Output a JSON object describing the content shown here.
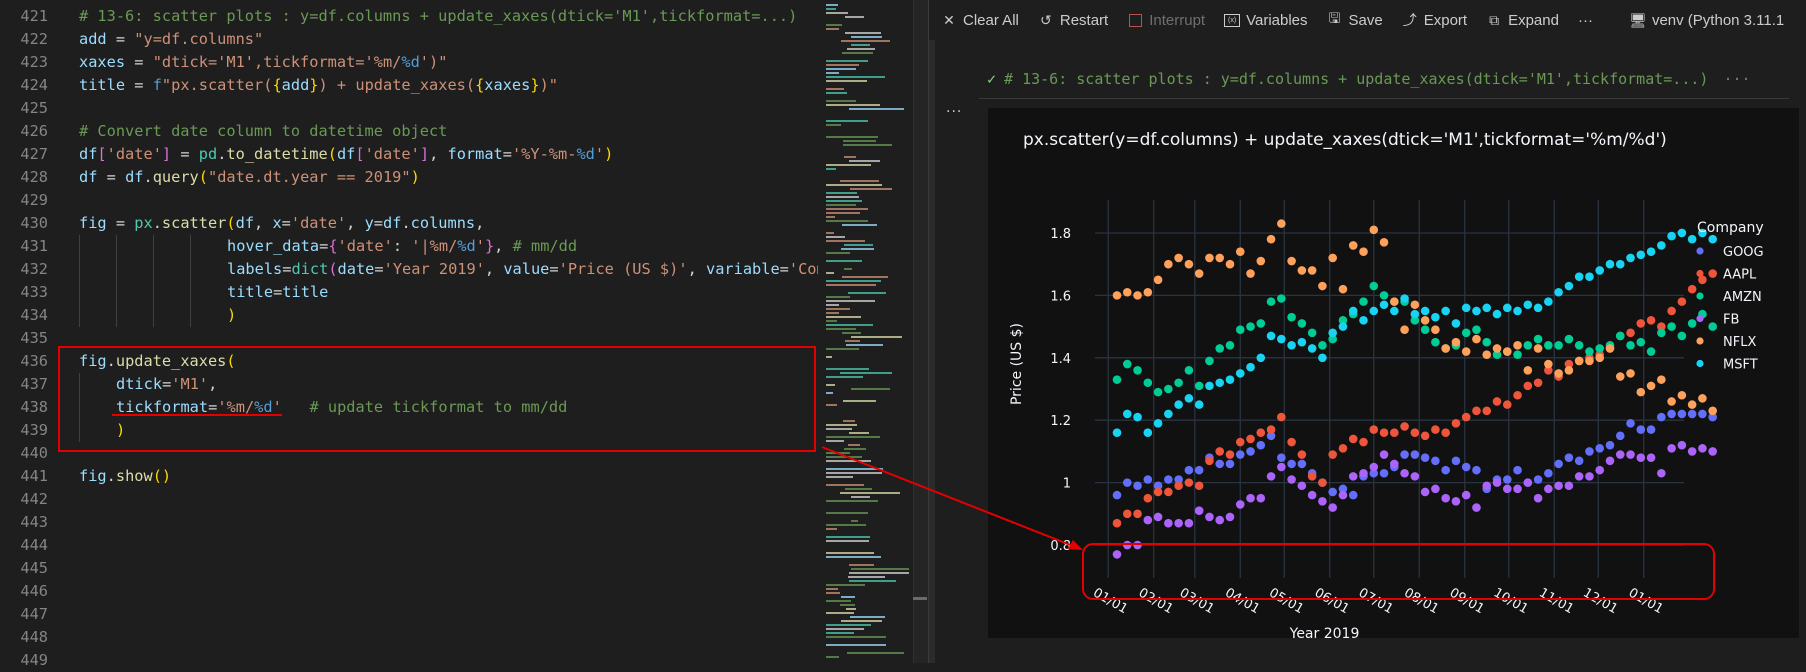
{
  "editor": {
    "lines": [
      {
        "n": "421",
        "tokens": [
          [
            "c-com",
            "# 13-6: scatter plots : y=df.columns + update_xaxes(dtick='M1',tickformat=...)"
          ]
        ]
      },
      {
        "n": "422",
        "tokens": [
          [
            "c-var",
            "add"
          ],
          [
            "c-op",
            " = "
          ],
          [
            "c-str",
            "\"y=df.columns\""
          ]
        ]
      },
      {
        "n": "423",
        "tokens": [
          [
            "c-var",
            "xaxes"
          ],
          [
            "c-op",
            " = "
          ],
          [
            "c-str",
            "\"dtick='M1',tickformat='"
          ],
          [
            "c-str",
            "%m/"
          ],
          [
            "c-esc",
            "%d"
          ],
          [
            "c-str",
            "')\""
          ]
        ]
      },
      {
        "n": "424",
        "tokens": [
          [
            "c-var",
            "title"
          ],
          [
            "c-op",
            " = "
          ],
          [
            "c-esc",
            "f"
          ],
          [
            "c-str",
            "\"px.scatter("
          ],
          [
            "c-br1",
            "{"
          ],
          [
            "c-var",
            "add"
          ],
          [
            "c-br1",
            "}"
          ],
          [
            "c-str",
            ") + update_xaxes("
          ],
          [
            "c-br1",
            "{"
          ],
          [
            "c-var",
            "xaxes"
          ],
          [
            "c-br1",
            "}"
          ],
          [
            "c-str",
            ")\""
          ]
        ]
      },
      {
        "n": "425",
        "tokens": []
      },
      {
        "n": "426",
        "tokens": [
          [
            "c-com",
            "# Convert date column to datetime object"
          ]
        ]
      },
      {
        "n": "427",
        "tokens": [
          [
            "c-var",
            "df"
          ],
          [
            "c-br2",
            "["
          ],
          [
            "c-str",
            "'date'"
          ],
          [
            "c-br2",
            "]"
          ],
          [
            "c-op",
            " = "
          ],
          [
            "c-mod",
            "pd"
          ],
          [
            "c-op",
            "."
          ],
          [
            "c-fn",
            "to_datetime"
          ],
          [
            "c-br1",
            "("
          ],
          [
            "c-var",
            "df"
          ],
          [
            "c-br2",
            "["
          ],
          [
            "c-str",
            "'date'"
          ],
          [
            "c-br2",
            "]"
          ],
          [
            "c-op",
            ", "
          ],
          [
            "c-var",
            "format"
          ],
          [
            "c-op",
            "="
          ],
          [
            "c-str",
            "'%Y-%m-"
          ],
          [
            "c-esc",
            "%d"
          ],
          [
            "c-str",
            "'"
          ],
          [
            "c-br1",
            ")"
          ]
        ]
      },
      {
        "n": "428",
        "tokens": [
          [
            "c-var",
            "df"
          ],
          [
            "c-op",
            " = "
          ],
          [
            "c-var",
            "df"
          ],
          [
            "c-op",
            "."
          ],
          [
            "c-fn",
            "query"
          ],
          [
            "c-br1",
            "("
          ],
          [
            "c-str",
            "\"date.dt.year == 2019\""
          ],
          [
            "c-br1",
            ")"
          ]
        ]
      },
      {
        "n": "429",
        "tokens": []
      },
      {
        "n": "430",
        "tokens": [
          [
            "c-var",
            "fig"
          ],
          [
            "c-op",
            " = "
          ],
          [
            "c-mod",
            "px"
          ],
          [
            "c-op",
            "."
          ],
          [
            "c-fn",
            "scatter"
          ],
          [
            "c-br1",
            "("
          ],
          [
            "c-var",
            "df"
          ],
          [
            "c-op",
            ", "
          ],
          [
            "c-var",
            "x"
          ],
          [
            "c-op",
            "="
          ],
          [
            "c-str",
            "'date'"
          ],
          [
            "c-op",
            ", "
          ],
          [
            "c-var",
            "y"
          ],
          [
            "c-op",
            "="
          ],
          [
            "c-var",
            "df"
          ],
          [
            "c-op",
            "."
          ],
          [
            "c-var",
            "columns"
          ],
          [
            "c-op",
            ","
          ]
        ]
      },
      {
        "n": "431",
        "indent": 16,
        "tokens": [
          [
            "c-var",
            "hover_data"
          ],
          [
            "c-op",
            "="
          ],
          [
            "c-br2",
            "{"
          ],
          [
            "c-str",
            "'date'"
          ],
          [
            "c-op",
            ": "
          ],
          [
            "c-str",
            "'|%m/"
          ],
          [
            "c-esc",
            "%d"
          ],
          [
            "c-str",
            "'"
          ],
          [
            "c-br2",
            "}"
          ],
          [
            "c-op",
            ", "
          ],
          [
            "c-com",
            "# mm/dd"
          ]
        ]
      },
      {
        "n": "432",
        "indent": 16,
        "tokens": [
          [
            "c-var",
            "labels"
          ],
          [
            "c-op",
            "="
          ],
          [
            "c-mod",
            "dict"
          ],
          [
            "c-br2",
            "("
          ],
          [
            "c-var",
            "date"
          ],
          [
            "c-op",
            "="
          ],
          [
            "c-str",
            "'Year 2019'"
          ],
          [
            "c-op",
            ", "
          ],
          [
            "c-var",
            "value"
          ],
          [
            "c-op",
            "="
          ],
          [
            "c-str",
            "'Price (US $)'"
          ],
          [
            "c-op",
            ", "
          ],
          [
            "c-var",
            "variable"
          ],
          [
            "c-op",
            "="
          ],
          [
            "c-str",
            "'Company'"
          ],
          [
            "c-br2",
            ")"
          ],
          [
            "c-op",
            ","
          ]
        ]
      },
      {
        "n": "433",
        "indent": 16,
        "tokens": [
          [
            "c-var",
            "title"
          ],
          [
            "c-op",
            "="
          ],
          [
            "c-var",
            "title"
          ]
        ]
      },
      {
        "n": "434",
        "indent": 16,
        "tokens": [
          [
            "c-br1",
            ")"
          ]
        ]
      },
      {
        "n": "435",
        "tokens": []
      },
      {
        "n": "436",
        "tokens": [
          [
            "c-var",
            "fig"
          ],
          [
            "c-op",
            "."
          ],
          [
            "c-fn",
            "update_xaxes"
          ],
          [
            "c-br1",
            "("
          ]
        ]
      },
      {
        "n": "437",
        "indent": 4,
        "tokens": [
          [
            "c-var",
            "dtick"
          ],
          [
            "c-op",
            "="
          ],
          [
            "c-str",
            "'M1'"
          ],
          [
            "c-op",
            ","
          ]
        ]
      },
      {
        "n": "438",
        "indent": 4,
        "tokens": [
          [
            "c-var",
            "tickformat"
          ],
          [
            "c-op",
            "="
          ],
          [
            "c-str",
            "'%m/"
          ],
          [
            "c-esc",
            "%d"
          ],
          [
            "c-str",
            "'"
          ],
          [
            "c-op",
            "   "
          ],
          [
            "c-com",
            "# update tickformat to mm/dd"
          ]
        ]
      },
      {
        "n": "439",
        "indent": 4,
        "tokens": [
          [
            "c-br1",
            ")"
          ]
        ]
      },
      {
        "n": "440",
        "tokens": []
      },
      {
        "n": "441",
        "tokens": [
          [
            "c-var",
            "fig"
          ],
          [
            "c-op",
            "."
          ],
          [
            "c-fn",
            "show"
          ],
          [
            "c-br1",
            "()"
          ]
        ]
      },
      {
        "n": "442",
        "tokens": []
      },
      {
        "n": "443",
        "tokens": []
      },
      {
        "n": "444",
        "tokens": []
      },
      {
        "n": "445",
        "tokens": []
      },
      {
        "n": "446",
        "tokens": []
      },
      {
        "n": "447",
        "tokens": []
      },
      {
        "n": "448",
        "tokens": []
      },
      {
        "n": "449",
        "tokens": []
      }
    ]
  },
  "toolbar": {
    "clear_all": "Clear All",
    "restart": "Restart",
    "interrupt": "Interrupt",
    "variables": "Variables",
    "save": "Save",
    "export": "Export",
    "expand": "Expand",
    "more": "···",
    "kernel": "venv (Python 3.11.1"
  },
  "cell": {
    "status": "✓",
    "header": "# 13-6: scatter plots : y=df.columns + update_xaxes(dtick='M1',tickformat=...)",
    "header_ellipsis": "···",
    "output_menu": "···"
  },
  "chart_data": {
    "type": "scatter",
    "title": "px.scatter(y=df.columns) + update_xaxes(dtick='M1',tickformat='%m/%d')",
    "xlabel": "Year 2019",
    "ylabel": "Price (US $)",
    "legend_title": "Company",
    "legend_position": "right",
    "grid": true,
    "ylim": [
      0.72,
      1.88
    ],
    "xlim": [
      "2018-12-23",
      "2020-01-08"
    ],
    "yticks": [
      0.8,
      1,
      1.2,
      1.4,
      1.6,
      1.8
    ],
    "ytick_labels": [
      "0.8",
      "1",
      "1.2",
      "1.4",
      "1.6",
      "1.8"
    ],
    "xtick_labels": [
      "01/01",
      "02/01",
      "03/01",
      "04/01",
      "05/01",
      "06/01",
      "07/01",
      "08/01",
      "09/01",
      "10/01",
      "11/01",
      "12/01",
      "01/01"
    ],
    "x_start": "2019-01-07",
    "x_step_days": 7,
    "series": [
      {
        "name": "GOOG",
        "color": "#636efa",
        "values": [
          0.96,
          1.0,
          0.99,
          1.01,
          0.99,
          1.01,
          1.01,
          1.04,
          1.04,
          1.08,
          1.06,
          1.06,
          1.09,
          1.1,
          1.12,
          1.15,
          1.08,
          1.06,
          1.06,
          1.03,
          1.0,
          0.97,
          0.98,
          0.96,
          1.02,
          1.03,
          1.03,
          1.05,
          1.09,
          1.09,
          1.08,
          1.07,
          1.04,
          1.07,
          1.05,
          1.04,
          0.98,
          1.01,
          1.01,
          1.04,
          1.0,
          1.01,
          1.03,
          1.06,
          1.08,
          1.07,
          1.1,
          1.11,
          1.12,
          1.15,
          1.19,
          1.17,
          1.17,
          1.21,
          1.22,
          1.22,
          1.22,
          1.22,
          1.21
        ]
      },
      {
        "name": "AAPL",
        "color": "#ef553b",
        "values": [
          0.87,
          0.9,
          0.9,
          0.95,
          0.97,
          0.97,
          0.99,
          1.0,
          0.99,
          1.07,
          1.1,
          1.09,
          1.13,
          1.14,
          1.16,
          1.17,
          1.21,
          1.13,
          1.09,
          1.02,
          1.0,
          1.09,
          1.11,
          1.14,
          1.13,
          1.17,
          1.16,
          1.16,
          1.18,
          1.16,
          1.15,
          1.17,
          1.16,
          1.19,
          1.21,
          1.23,
          1.23,
          1.26,
          1.25,
          1.28,
          1.31,
          1.32,
          1.36,
          1.34,
          1.38,
          1.39,
          1.4,
          1.41,
          1.43,
          1.47,
          1.48,
          1.51,
          1.52,
          1.5,
          1.55,
          1.58,
          1.62,
          1.65,
          1.67
        ]
      },
      {
        "name": "AMZN",
        "color": "#00cc96",
        "values": [
          1.33,
          1.38,
          1.36,
          1.32,
          1.29,
          1.3,
          1.32,
          1.36,
          1.31,
          1.39,
          1.43,
          1.44,
          1.49,
          1.5,
          1.51,
          1.58,
          1.59,
          1.53,
          1.51,
          1.48,
          1.44,
          1.46,
          1.52,
          1.54,
          1.58,
          1.63,
          1.6,
          1.58,
          1.58,
          1.52,
          1.49,
          1.45,
          1.43,
          1.44,
          1.48,
          1.49,
          1.45,
          1.41,
          1.42,
          1.41,
          1.44,
          1.46,
          1.44,
          1.44,
          1.46,
          1.44,
          1.42,
          1.43,
          1.44,
          1.47,
          1.44,
          1.45,
          1.42,
          1.48,
          1.5,
          1.47,
          1.51,
          1.54,
          1.5
        ]
      },
      {
        "name": "FB",
        "color": "#ab63fa",
        "values": [
          0.77,
          0.8,
          0.8,
          0.88,
          0.89,
          0.87,
          0.87,
          0.87,
          0.91,
          0.89,
          0.88,
          0.89,
          0.93,
          0.95,
          0.95,
          1.02,
          1.05,
          1.01,
          0.99,
          0.96,
          0.94,
          0.92,
          0.96,
          1.02,
          1.03,
          1.05,
          1.09,
          1.06,
          1.03,
          1.02,
          0.97,
          0.98,
          0.95,
          0.94,
          0.96,
          0.92,
          0.99,
          1.0,
          0.98,
          0.98,
          1.0,
          0.95,
          0.98,
          0.99,
          0.99,
          1.02,
          1.02,
          1.04,
          1.07,
          1.09,
          1.09,
          1.08,
          1.08,
          1.03,
          1.11,
          1.12,
          1.1,
          1.11,
          1.1
        ]
      },
      {
        "name": "NFLX",
        "color": "#ffa15a",
        "values": [
          1.6,
          1.61,
          1.6,
          1.61,
          1.65,
          1.7,
          1.72,
          1.7,
          1.67,
          1.72,
          1.72,
          1.7,
          1.74,
          1.67,
          1.71,
          1.78,
          1.83,
          1.71,
          1.68,
          1.68,
          1.63,
          1.72,
          1.62,
          1.76,
          1.74,
          1.81,
          1.77,
          1.58,
          1.49,
          1.57,
          1.52,
          1.49,
          1.43,
          1.45,
          1.42,
          1.46,
          1.41,
          1.43,
          1.42,
          1.44,
          1.36,
          1.43,
          1.38,
          1.35,
          1.36,
          1.39,
          1.39,
          1.4,
          1.43,
          1.34,
          1.35,
          1.29,
          1.31,
          1.33,
          1.26,
          1.28,
          1.25,
          1.27,
          1.23
        ]
      },
      {
        "name": "MSFT",
        "color": "#19d3f3",
        "values": [
          1.16,
          1.22,
          1.21,
          1.16,
          1.19,
          1.22,
          1.25,
          1.27,
          1.25,
          1.31,
          1.32,
          1.33,
          1.35,
          1.37,
          1.4,
          1.47,
          1.46,
          1.44,
          1.45,
          1.43,
          1.4,
          1.48,
          1.5,
          1.55,
          1.52,
          1.55,
          1.57,
          1.55,
          1.59,
          1.54,
          1.55,
          1.53,
          1.55,
          1.51,
          1.56,
          1.55,
          1.56,
          1.54,
          1.56,
          1.55,
          1.57,
          1.56,
          1.58,
          1.61,
          1.63,
          1.66,
          1.66,
          1.68,
          1.7,
          1.7,
          1.72,
          1.73,
          1.74,
          1.76,
          1.79,
          1.8,
          1.78,
          1.8,
          1.78
        ]
      }
    ]
  }
}
